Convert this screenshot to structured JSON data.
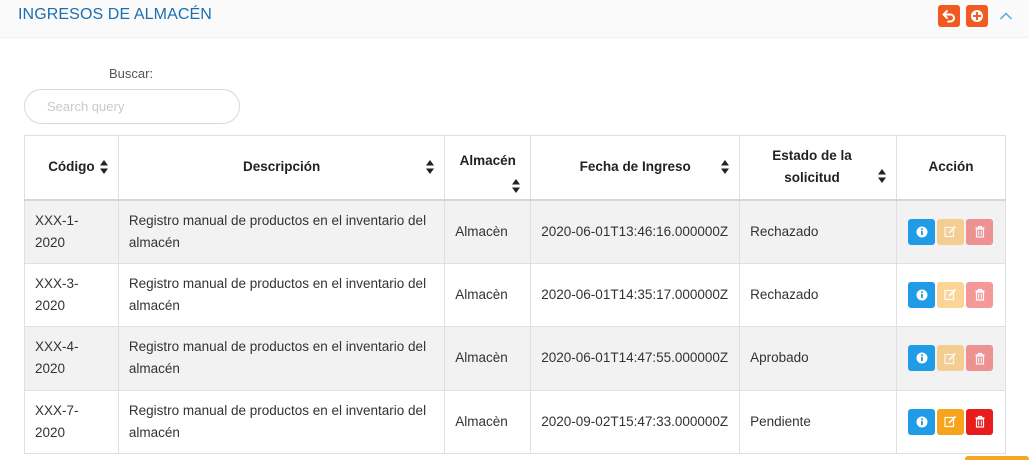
{
  "header": {
    "title": "INGRESOS DE ALMACÉN",
    "back_icon": "undo-arrow-icon",
    "add_icon": "plus-circle-icon",
    "collapse_icon": "chevron-up-icon",
    "accent_color": "#f05a22",
    "title_color": "#1a6fb0"
  },
  "search": {
    "label": "Buscar:",
    "placeholder": "Search query",
    "value": ""
  },
  "table": {
    "columns": [
      "Código",
      "Descripción",
      "Almacén",
      "Fecha de Ingreso",
      "Estado de la solicitud",
      "Acción"
    ],
    "rows": [
      {
        "codigo": "XXX-1-2020",
        "descripcion": "Registro manual de productos en el inventario del almacén",
        "almacen": "Almacèn",
        "fecha": "2020-06-01T13:46:16.000000Z",
        "estado": "Rechazado",
        "actions_enabled": false
      },
      {
        "codigo": "XXX-3-2020",
        "descripcion": "Registro manual de productos en el inventario del almacén",
        "almacen": "Almacèn",
        "fecha": "2020-06-01T14:35:17.000000Z",
        "estado": "Rechazado",
        "actions_enabled": false
      },
      {
        "codigo": "XXX-4-2020",
        "descripcion": "Registro manual de productos en el inventario del almacén",
        "almacen": "Almacèn",
        "fecha": "2020-06-01T14:47:55.000000Z",
        "estado": "Aprobado",
        "actions_enabled": false
      },
      {
        "codigo": "XXX-7-2020",
        "descripcion": "Registro manual de productos en el inventario del almacén",
        "almacen": "Almacèn",
        "fecha": "2020-09-02T15:47:33.000000Z",
        "estado": "Pendiente",
        "actions_enabled": true
      }
    ],
    "action_icons": [
      "info-icon",
      "edit-icon",
      "trash-icon"
    ],
    "action_colors": {
      "info": "#1f9be8",
      "edit": "#f7a31b",
      "delete": "#e71d1d"
    }
  }
}
